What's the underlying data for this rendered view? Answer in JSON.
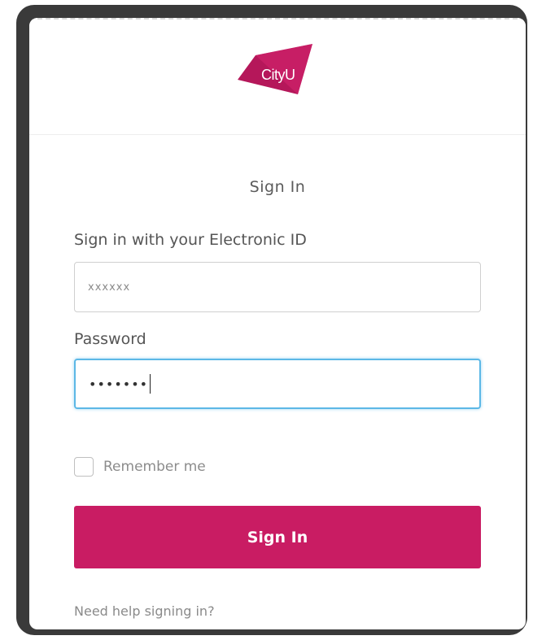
{
  "brand": {
    "logo_text": "CityU",
    "accent_color": "#c91c63"
  },
  "form": {
    "title": "Sign In",
    "id_label": "Sign in with your Electronic ID",
    "id_value": "xxxxxx",
    "password_label": "Password",
    "password_value": "•••••••",
    "remember_label": "Remember me",
    "remember_checked": false,
    "submit_label": "Sign In",
    "help_link": "Need help signing in?"
  }
}
